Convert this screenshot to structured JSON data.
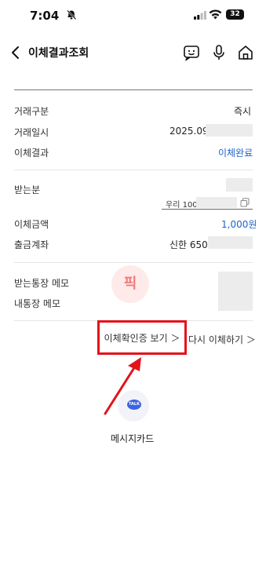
{
  "status_bar": {
    "time": "7:04",
    "battery": "32"
  },
  "header": {
    "title": "이체결과조회"
  },
  "details": {
    "transfer_type_label": "거래구분",
    "transfer_type_value": "즉시",
    "transfer_datetime_label": "거래일시",
    "transfer_datetime_value": "2025.09",
    "transfer_result_label": "이체결과",
    "transfer_result_value": "이체완료",
    "recipient_label": "받는분",
    "recipient_account": "우리 100",
    "amount_label": "이체금액",
    "amount_value": "1,000원",
    "withdraw_account_label": "출금계좌",
    "withdraw_account_value": "신한 650",
    "recipient_memo_label": "받는통장 메모",
    "my_memo_label": "내통장 메모"
  },
  "watermark": {
    "text": "픽"
  },
  "actions": {
    "certificate_label": "이체확인증 보기 ＞",
    "transfer_again_label": "다시 이체하기 ＞"
  },
  "share": {
    "kakao_badge": "TALK",
    "label": "메시지카드"
  },
  "colors": {
    "accent_blue": "#1f63c6",
    "highlight_red": "#e3131b",
    "kakao_blue": "#3d63e0"
  }
}
